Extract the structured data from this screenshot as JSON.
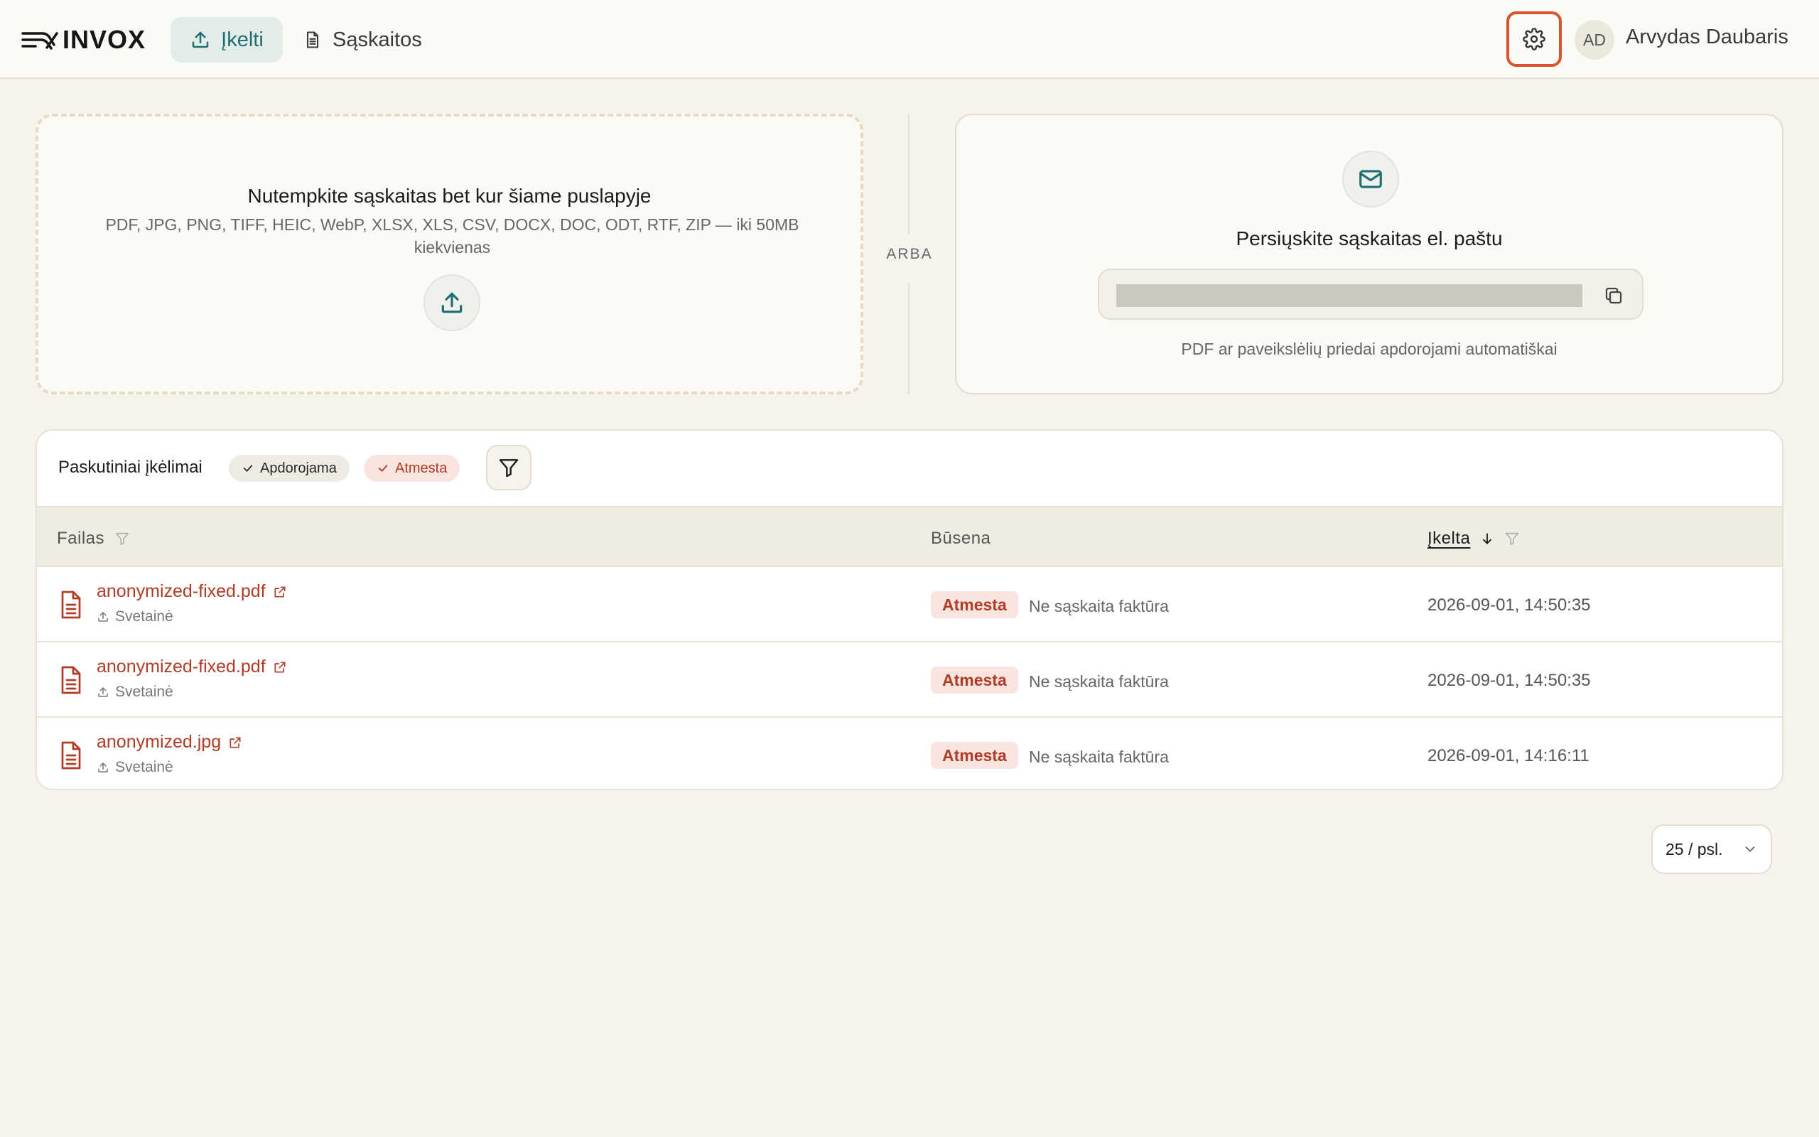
{
  "app": {
    "name": "INVOX"
  },
  "nav": {
    "upload_label": "Įkelti",
    "invoices_label": "Sąskaitos"
  },
  "user": {
    "initials": "AD",
    "name": "Arvydas Daubaris"
  },
  "dropzone": {
    "title": "Nutempkite sąskaitas bet kur šiame puslapyje",
    "formats": "PDF, JPG, PNG, TIFF, HEIC, WebP, XLSX, XLS, CSV, DOCX, DOC, ODT, RTF, ZIP — iki 50MB kiekvienas"
  },
  "divider": {
    "label": "ARBA"
  },
  "email": {
    "title": "Persiųskite sąskaitas el. paštu",
    "note": "PDF ar paveikslėlių priedai apdorojami automatiškai"
  },
  "uploads": {
    "title": "Paskutiniai įkėlimai",
    "chips": [
      "Apdorojama",
      "Atmesta"
    ],
    "columns": {
      "file": "Failas",
      "status": "Būsena",
      "uploaded": "Įkelta"
    },
    "rows": [
      {
        "file": "anonymized-fixed.pdf",
        "source": "Svetainė",
        "status": "Atmesta",
        "reason": "Ne sąskaita faktūra",
        "date": "2026-09-01, 14:50:35"
      },
      {
        "file": "anonymized-fixed.pdf",
        "source": "Svetainė",
        "status": "Atmesta",
        "reason": "Ne sąskaita faktūra",
        "date": "2026-09-01, 14:50:35"
      },
      {
        "file": "anonymized.jpg",
        "source": "Svetainė",
        "status": "Atmesta",
        "reason": "Ne sąskaita faktūra",
        "date": "2026-09-01, 14:16:11"
      }
    ]
  },
  "pagination": {
    "page_size": "25 / psl."
  },
  "colors": {
    "accent": "#1f6e73",
    "danger": "#b23b26",
    "highlight": "#d9542e"
  }
}
